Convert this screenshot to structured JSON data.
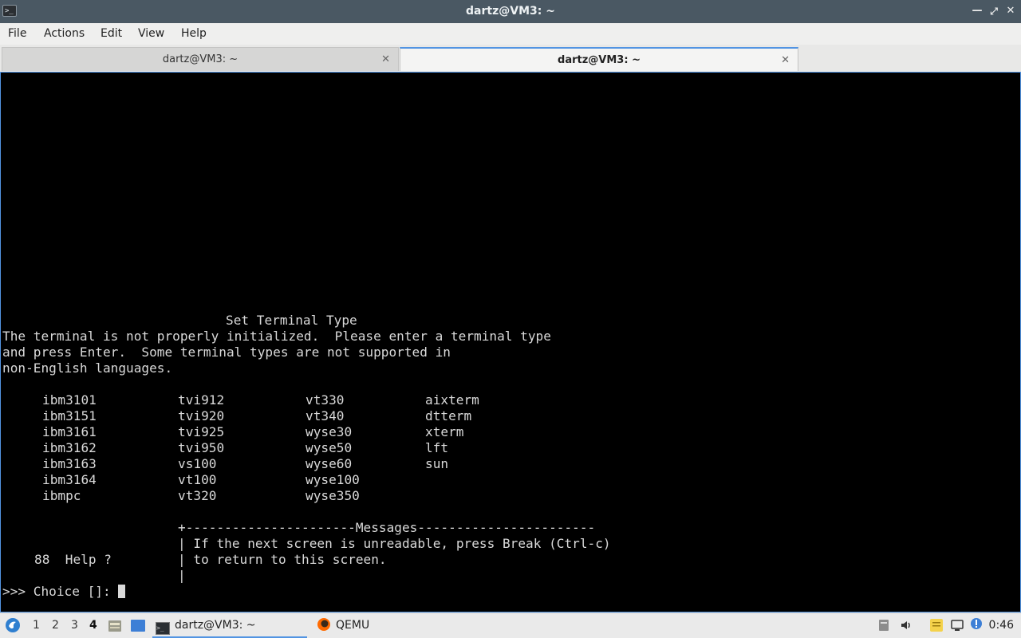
{
  "window": {
    "title": "dartz@VM3: ~"
  },
  "menu": {
    "items": [
      "File",
      "Actions",
      "Edit",
      "View",
      "Help"
    ]
  },
  "tabs": [
    {
      "label": "dartz@VM3: ~",
      "active": false
    },
    {
      "label": "dartz@VM3: ~",
      "active": true
    }
  ],
  "terminal": {
    "heading": "Set Terminal Type",
    "intro": [
      "The terminal is not properly initialized.  Please enter a terminal type",
      "and press Enter.  Some terminal types are not supported in",
      "non-English languages."
    ],
    "table": [
      [
        "ibm3101",
        "tvi912",
        "vt330",
        "aixterm"
      ],
      [
        "ibm3151",
        "tvi920",
        "vt340",
        "dtterm"
      ],
      [
        "ibm3161",
        "tvi925",
        "wyse30",
        "xterm"
      ],
      [
        "ibm3162",
        "tvi950",
        "wyse50",
        "lft"
      ],
      [
        "ibm3163",
        "vs100",
        "wyse60",
        "sun"
      ],
      [
        "ibm3164",
        "vt100",
        "wyse100",
        ""
      ],
      [
        "ibmpc",
        "vt320",
        "wyse350",
        ""
      ]
    ],
    "messages_rule": "+----------------------Messages-----------------------",
    "messages": [
      "| If the next screen is unreadable, press Break (Ctrl-c)",
      "| to return to this screen.",
      "|"
    ],
    "help": "88  Help ?",
    "prompt": ">>> Choice []: "
  },
  "taskbar": {
    "workspaces": [
      "1",
      "2",
      "3",
      "4"
    ],
    "current_workspace": "4",
    "tasks": [
      {
        "label": "dartz@VM3: ~",
        "icon": "terminal-icon",
        "active": true
      },
      {
        "label": "QEMU",
        "icon": "qemu-icon",
        "active": false
      }
    ],
    "clock": "0:46"
  },
  "colors": {
    "accent": "#5294e2",
    "titlebar": "#4a5863",
    "terminal_bg": "#000000",
    "terminal_fg": "#d9d9d9"
  }
}
